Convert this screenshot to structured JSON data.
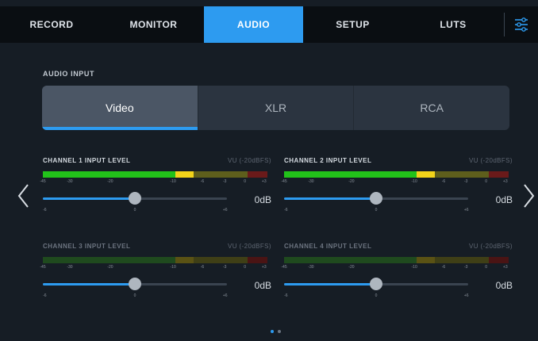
{
  "tabs": [
    "RECORD",
    "MONITOR",
    "AUDIO",
    "SETUP",
    "LUTS"
  ],
  "active_tab": "AUDIO",
  "section": {
    "title": "AUDIO INPUT"
  },
  "inputs": {
    "options": [
      "Video",
      "XLR",
      "RCA"
    ],
    "selected": "Video"
  },
  "scale_ticks": [
    "-45",
    "-30",
    "-20",
    "-10",
    "-6",
    "-3",
    "0",
    "+3"
  ],
  "slider_ticks": [
    "-6",
    "0",
    "+6"
  ],
  "channels": [
    {
      "label": "CHANNEL 1 INPUT LEVEL",
      "scale": "VU (-20dBFS)",
      "gain": "0dB",
      "slider_level": 0.5,
      "meter_level": 0.66,
      "active": true
    },
    {
      "label": "CHANNEL 2 INPUT LEVEL",
      "scale": "VU (-20dBFS)",
      "gain": "0dB",
      "slider_level": 0.5,
      "meter_level": 0.66,
      "active": true
    },
    {
      "label": "CHANNEL 3 INPUT LEVEL",
      "scale": "VU (-20dBFS)",
      "gain": "0dB",
      "slider_level": 0.5,
      "meter_level": 0.0,
      "active": false
    },
    {
      "label": "CHANNEL 4 INPUT LEVEL",
      "scale": "VU (-20dBFS)",
      "gain": "0dB",
      "slider_level": 0.5,
      "meter_level": 0.0,
      "active": false
    }
  ],
  "pagination": {
    "total": 2,
    "current": 1
  },
  "icons": {
    "settings": "sliders-icon",
    "prev": "chevron-left-icon",
    "next": "chevron-right-icon"
  },
  "colors": {
    "accent": "#2d9bf0",
    "green": "#22c21a",
    "yellow": "#f2d31a",
    "red": "#c62828"
  }
}
